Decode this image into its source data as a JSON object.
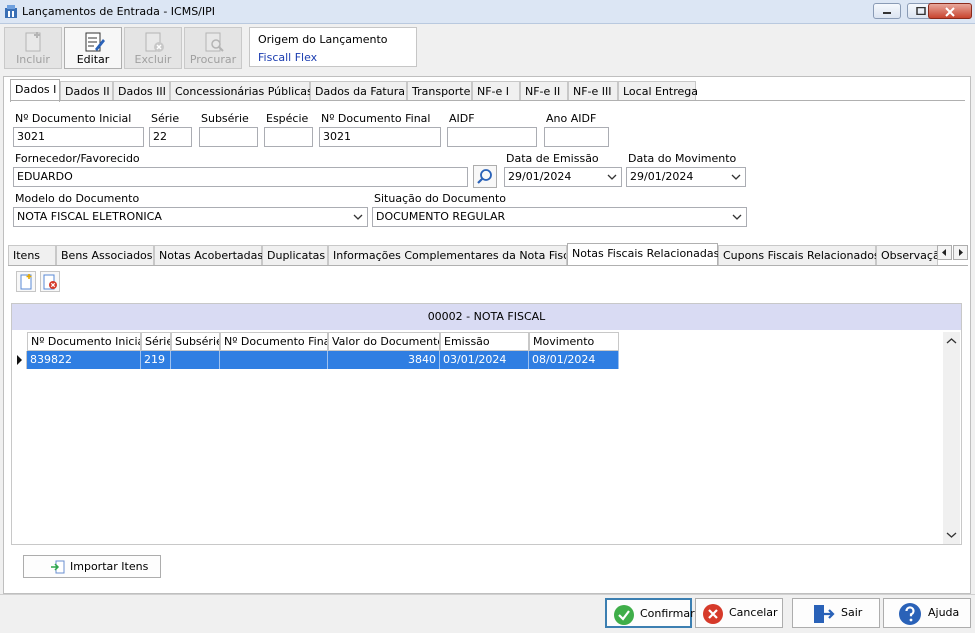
{
  "window": {
    "title": "Lançamentos de Entrada - ICMS/IPI"
  },
  "toolbar": {
    "incluir": "Incluir",
    "editar": "Editar",
    "excluir": "Excluir",
    "procurar": "Procurar"
  },
  "origin": {
    "label": "Origem do Lançamento",
    "value": "Fiscall Flex"
  },
  "top_tabs": [
    "Dados I",
    "Dados II",
    "Dados III",
    "Concessionárias Públicas",
    "Dados da Fatura",
    "Transporte",
    "NF-e I",
    "NF-e II",
    "NF-e III",
    "Local Entrega"
  ],
  "form": {
    "doc_inicial": {
      "label": "Nº Documento Inicial",
      "value": "3021"
    },
    "serie": {
      "label": "Série",
      "value": "22"
    },
    "subserie": {
      "label": "Subsérie",
      "value": ""
    },
    "especie": {
      "label": "Espécie",
      "value": ""
    },
    "doc_final": {
      "label": "Nº Documento Final",
      "value": "3021"
    },
    "aidf": {
      "label": "AIDF",
      "value": ""
    },
    "ano_aidf": {
      "label": "Ano AIDF",
      "value": ""
    },
    "fornecedor": {
      "label": "Fornecedor/Favorecido",
      "value": "EDUARDO"
    },
    "data_emissao": {
      "label": "Data de Emissão",
      "value": "29/01/2024"
    },
    "data_movimento": {
      "label": "Data do Movimento",
      "value": "29/01/2024"
    },
    "modelo": {
      "label": "Modelo do Documento",
      "value": "NOTA FISCAL ELETRONICA"
    },
    "situacao": {
      "label": "Situação do Documento",
      "value": "DOCUMENTO REGULAR"
    }
  },
  "sub_tabs": [
    "Itens",
    "Bens Associados",
    "Notas Acobertadas",
    "Duplicatas",
    "Informações Complementares da Nota Fiscal",
    "Notas Fiscais Relacionadas",
    "Cupons Fiscais Relacionados",
    "Observaçã"
  ],
  "grid": {
    "title": "00002  -   NOTA FISCAL",
    "columns": [
      "Nº Documento Inicial",
      "Série",
      "Subsérie",
      "Nº Documento Final",
      "Valor do Documento",
      "Emissão",
      "Movimento"
    ],
    "rows": [
      [
        "839822",
        "219",
        "",
        "",
        "3840",
        "03/01/2024",
        "08/01/2024"
      ]
    ]
  },
  "import_button": "Importar Itens",
  "bottom_buttons": {
    "confirmar": "Confirmar",
    "cancelar": "Cancelar",
    "sair": "Sair",
    "ajuda": "Ajuda"
  },
  "colors": {
    "selection": "#2f7ee2",
    "grid_header": "#d9dbf3",
    "origin_value": "#1a3cb0"
  }
}
